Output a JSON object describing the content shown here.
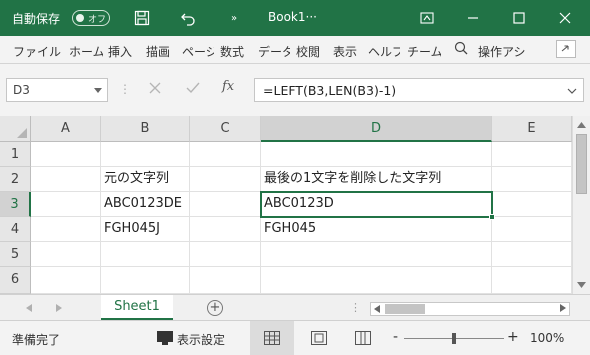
{
  "titlebar": {
    "autosave_label": "自動保存",
    "autosave_state": "オフ",
    "doc_title": "Book1···",
    "bg_color": "#217346"
  },
  "ribbon": {
    "tabs": [
      "ファイル",
      "ホーム",
      "挿入",
      "描画",
      "ページ",
      "数式",
      "データ",
      "校閲",
      "表示",
      "ヘルプ",
      "チーム"
    ],
    "search_label": "操作アシ"
  },
  "formula_bar": {
    "name_box": "D3",
    "fx": "fx",
    "formula": "=LEFT(B3,LEN(B3)-1)"
  },
  "grid": {
    "columns": [
      "A",
      "B",
      "C",
      "D",
      "E"
    ],
    "rows": [
      "1",
      "2",
      "3",
      "4",
      "5",
      "6"
    ],
    "cells": {
      "B2": "元の文字列",
      "D2": "最後の1文字を削除した文字列",
      "B3": "ABC0123DE",
      "D3": "ABC0123D",
      "B4": "FGH045J",
      "D4": "FGH045"
    },
    "selected_cell": "D3",
    "accent": "#217346"
  },
  "sheets": {
    "tabs": [
      "Sheet1"
    ],
    "active": "Sheet1",
    "add_symbol": "+"
  },
  "status": {
    "ready": "準備完了",
    "display_settings": "表示設定",
    "zoom": "100%",
    "zoom_minus": "-",
    "zoom_plus": "+"
  }
}
